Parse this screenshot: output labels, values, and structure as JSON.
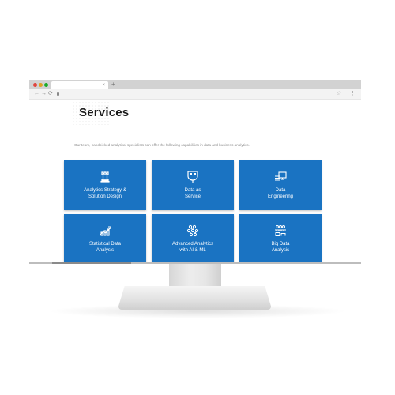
{
  "browser": {
    "tab_close": "×",
    "new_tab": "+",
    "nav": {
      "back": "←",
      "forward": "→",
      "reload": "⟳"
    },
    "address": "",
    "star": "☆",
    "menu": "⋮"
  },
  "page": {
    "title": "Services",
    "subtitle": "Our team, handpicked analytical specialists can offer the following capabilities in data and business analytics.",
    "accent_color": "#1a73c2",
    "services": [
      {
        "label": "Analytics Strategy &\nSolution Design",
        "icon": "chess-rook-icon"
      },
      {
        "label": "Data as\nService",
        "icon": "data-service-icon"
      },
      {
        "label": "Data\nEngineering",
        "icon": "server-monitor-icon"
      },
      {
        "label": "Statistical Data\nAnalysis",
        "icon": "statistics-chart-icon"
      },
      {
        "label": "Advanced Analytics\nwith AI & ML",
        "icon": "neural-network-icon"
      },
      {
        "label": "Big Data\nAnalysis",
        "icon": "big-data-icon"
      }
    ]
  }
}
